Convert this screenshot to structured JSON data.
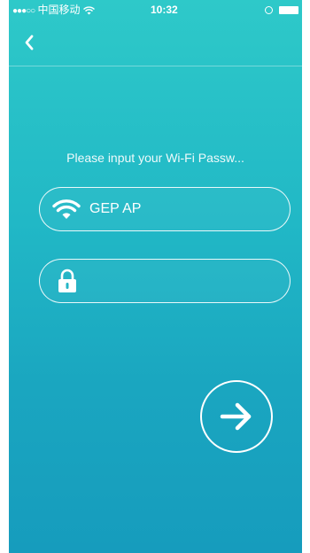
{
  "status_bar": {
    "signal_dots": "●●●○○",
    "carrier": "中国移动",
    "wifi_icon": "wifi-icon",
    "time": "10:32",
    "rotation_lock_icon": "rotation-lock-icon",
    "battery_icon": "battery-icon"
  },
  "nav": {
    "back_icon": "chevron-left-icon"
  },
  "main": {
    "prompt": "Please input your Wi-Fi Passw...",
    "ssid_field": {
      "icon": "wifi-icon",
      "value": "GEP AP"
    },
    "password_field": {
      "icon": "lock-icon",
      "value": "",
      "placeholder": ""
    },
    "next_button_icon": "arrow-right-icon"
  },
  "colors": {
    "background_top": "#2ec9c9",
    "background_bottom": "#169cbd",
    "foreground": "#ffffff"
  }
}
